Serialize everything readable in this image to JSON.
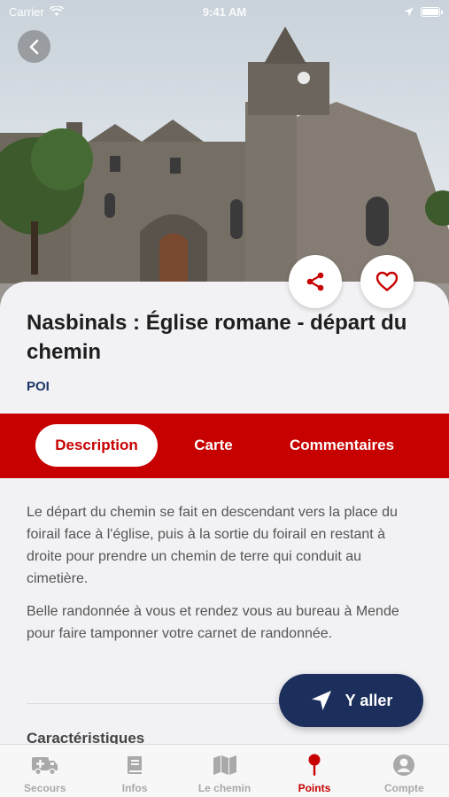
{
  "status_bar": {
    "carrier": "Carrier",
    "time": "9:41 AM"
  },
  "poi": {
    "title": "Nasbinals : Église romane - départ du chemin",
    "type": "POI"
  },
  "tabs": [
    {
      "label": "Description",
      "active": true
    },
    {
      "label": "Carte",
      "active": false
    },
    {
      "label": "Commentaires",
      "active": false
    }
  ],
  "description": [
    "Le départ du chemin se fait en descendant vers la place du foirail face à l'église, puis à la sortie du foirail en restant à droite pour prendre un chemin de terre qui conduit au cimetière.",
    "Belle randonnée à vous et rendez vous au bureau à Mende pour faire tamponner votre carnet de randonnée."
  ],
  "section_title": "Caractéristiques",
  "go_button": {
    "label": "Y aller"
  },
  "tabbar": [
    {
      "label": "Secours",
      "icon": "ambulance-icon",
      "active": false
    },
    {
      "label": "Infos",
      "icon": "book-icon",
      "active": false
    },
    {
      "label": "Le chemin",
      "icon": "map-icon",
      "active": false
    },
    {
      "label": "Points",
      "icon": "map-pin-icon",
      "active": true
    },
    {
      "label": "Compte",
      "icon": "user-icon",
      "active": false
    }
  ],
  "colors": {
    "brand_red": "#c70000",
    "navy": "#1b2e5c",
    "inactive": "#a9a9a9"
  }
}
